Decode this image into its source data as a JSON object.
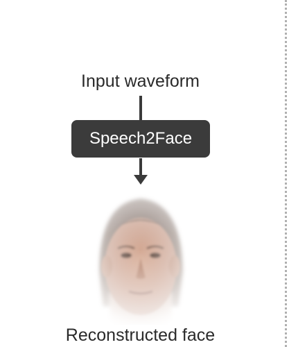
{
  "input_label": "Input waveform",
  "model_label": "Speech2Face",
  "output_label": "Reconstructed face",
  "colors": {
    "waveform_start": "#1fa5b6",
    "waveform_end": "#1d2a6b",
    "box": "#3b3b3b",
    "connector": "#3a3a3a",
    "text": "#2a2a2a",
    "skin": "#c79c86",
    "hair": "#6d5548"
  }
}
